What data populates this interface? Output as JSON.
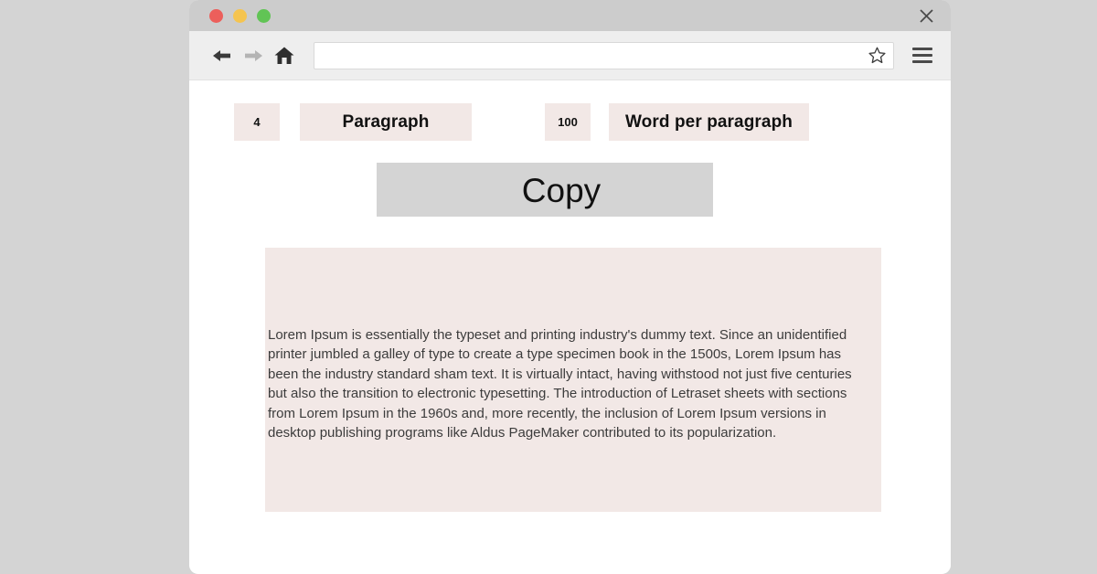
{
  "window": {
    "titlebar": {
      "traffic_lights": [
        {
          "name": "close-dot",
          "color": "#ec5f5b"
        },
        {
          "name": "minimize-dot",
          "color": "#f5c44f"
        },
        {
          "name": "maximize-dot",
          "color": "#61c455"
        }
      ],
      "close_label": "✕"
    },
    "toolbar": {
      "back_label": "←",
      "forward_label": "→",
      "home_label": "home-icon",
      "address_value": "",
      "address_placeholder": "",
      "bookmark_label": "bookmark-star-icon",
      "menu_label": "hamburger-menu-icon"
    }
  },
  "page": {
    "controls": {
      "paragraph_count_value": "4",
      "paragraph_label": "Paragraph",
      "words_per_paragraph_value": "100",
      "words_per_paragraph_label": "Word per paragraph"
    },
    "copy_button_label": "Copy",
    "output_text": "Lorem Ipsum is essentially the typeset and printing industry's dummy text. Since an unidentified printer jumbled a galley of type to create a type specimen book in the 1500s, Lorem Ipsum has been the industry standard sham text. It is virtually intact, having withstood not just five centuries but also the transition to electronic typesetting. The introduction of Letraset sheets with sections from Lorem Ipsum in the 1960s and, more recently, the inclusion of Lorem Ipsum versions in desktop publishing programs like Aldus PageMaker contributed to its popularization."
  },
  "colors": {
    "page_background": "#d4d4d4",
    "titlebar": "#cccccc",
    "toolbar": "#eeeeee",
    "field_accent": "#f2e8e6",
    "copy_button": "#d4d4d4"
  }
}
